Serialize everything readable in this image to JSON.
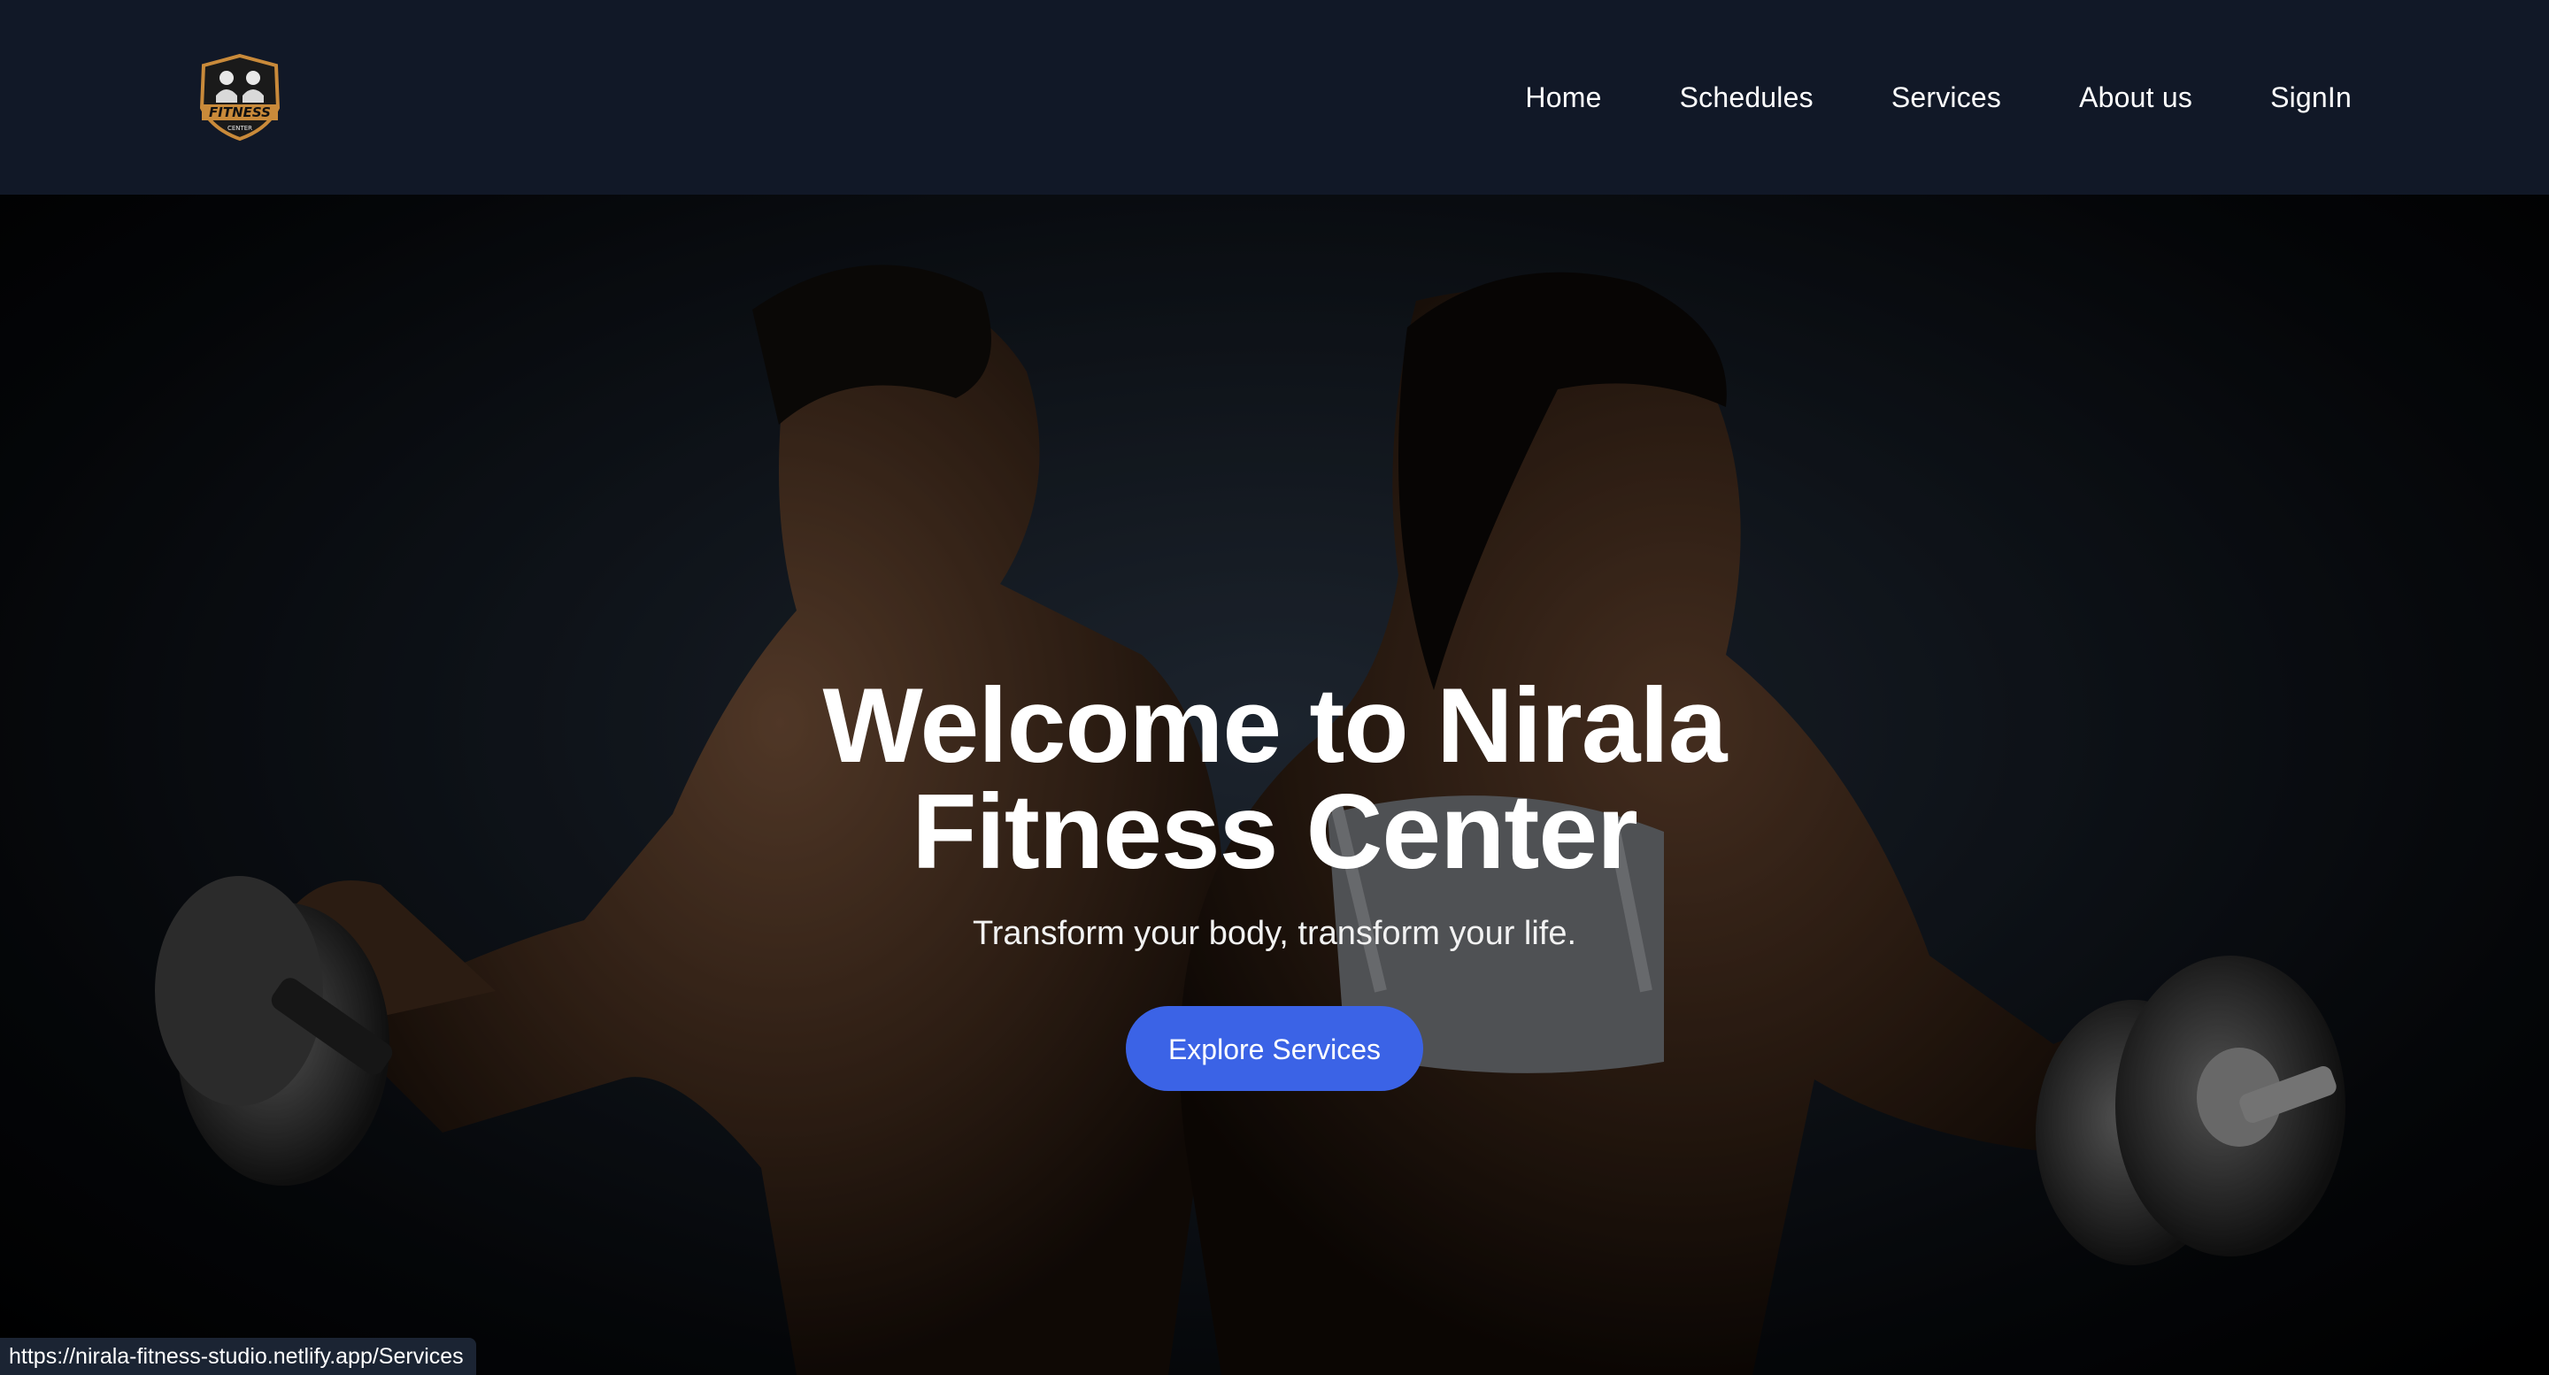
{
  "header": {
    "logo_alt": "Fitness Center logo",
    "logo_text": "FITNESS",
    "logo_subtext": "CENTER",
    "nav": [
      {
        "label": "Home"
      },
      {
        "label": "Schedules"
      },
      {
        "label": "Services"
      },
      {
        "label": "About us"
      },
      {
        "label": "SignIn"
      }
    ]
  },
  "hero": {
    "title": "Welcome to Nirala Fitness Center",
    "subtitle": "Transform your body, transform your life.",
    "cta_label": "Explore Services",
    "background_description_icon": "gym-couple-with-dumbbells-image"
  },
  "status_bar": {
    "url": "https://nirala-fitness-studio.netlify.app/Services"
  },
  "colors": {
    "navbar_bg": "#111827",
    "cta_bg": "#3b63e6",
    "text": "#ffffff"
  }
}
